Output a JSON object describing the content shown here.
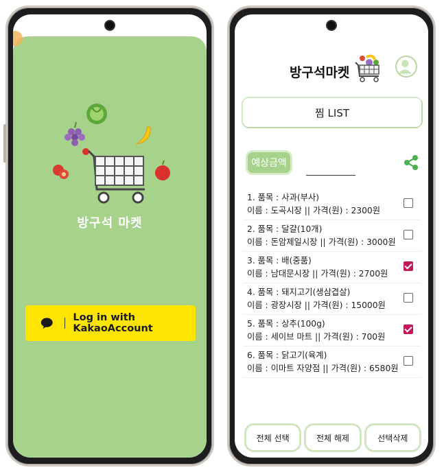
{
  "login": {
    "brand": "방구석 마켓",
    "kakao_button": "Log in with KakaoAccount"
  },
  "app": {
    "title": "방구석마켓",
    "tab": "찜 LIST",
    "estimate_button": "예상금액",
    "items": [
      {
        "line1": "1. 품목 :  사과(부사)",
        "line2": "이름 :  도곡시장 || 가격(원) :  2300원",
        "checked": false
      },
      {
        "line1": "2. 품목 :  달걀(10개)",
        "line2": "이름 :  돈암제일시장 || 가격(원) :  3000원",
        "checked": false
      },
      {
        "line1": "3. 품목 :  배(중품)",
        "line2": "이름 :  남대문시장 || 가격(원) :  2700원",
        "checked": true
      },
      {
        "line1": "4. 품목 :  돼지고기(생삼겹살)",
        "line2": "이름 :  광장시장 || 가격(원) :  15000원",
        "checked": false
      },
      {
        "line1": "5. 품목 :  상추(100g)",
        "line2": "이름 :  세이브 마트 || 가격(원) :  700원",
        "checked": true
      },
      {
        "line1": "6. 품목 :  닭고기(육계)",
        "line2": "이름 :  이마트 자양점 || 가격(원) :  6580원",
        "checked": false
      }
    ],
    "buttons": {
      "select_all": "전체 선택",
      "deselect_all": "전체 해제",
      "delete_selected": "선택삭제"
    }
  },
  "colors": {
    "accent_green": "#a6d28b",
    "kakao_yellow": "#fee500",
    "check_magenta": "#c2185b"
  }
}
